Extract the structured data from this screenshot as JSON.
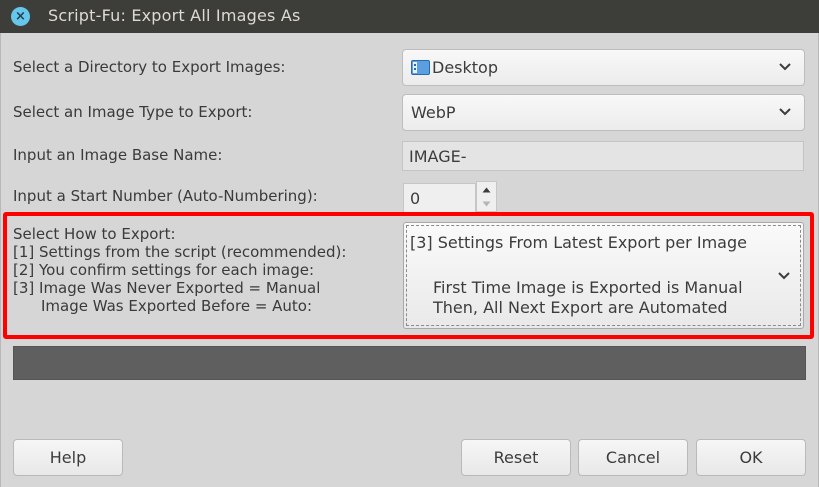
{
  "window": {
    "title": "Script-Fu: Export All Images As",
    "close_icon": "×"
  },
  "fields": {
    "directory": {
      "label": "Select a Directory to Export Images:",
      "value": "Desktop",
      "icon": "folder-icon"
    },
    "image_type": {
      "label": "Select an Image Type to Export:",
      "value": "WebP"
    },
    "base_name": {
      "label": "Input an Image Base Name:",
      "value": "IMAGE-"
    },
    "start_number": {
      "label": "Input a Start Number (Auto-Numbering):",
      "value": "0"
    },
    "export_mode": {
      "label_lines": [
        "Select How to Export:",
        "[1] Settings from the script (recommended):",
        "[2] You confirm settings for each image:",
        "[3] Image Was Never Exported = Manual",
        "Image Was Exported Before = Auto:"
      ],
      "value_lines": [
        "[3] Settings From Latest Export per Image",
        "First Time Image is Exported is Manual",
        "Then, All Next Export are Automated"
      ]
    }
  },
  "highlight_color": "#ff0000",
  "buttons": {
    "help": "Help",
    "reset": "Reset",
    "cancel": "Cancel",
    "ok": "OK"
  }
}
